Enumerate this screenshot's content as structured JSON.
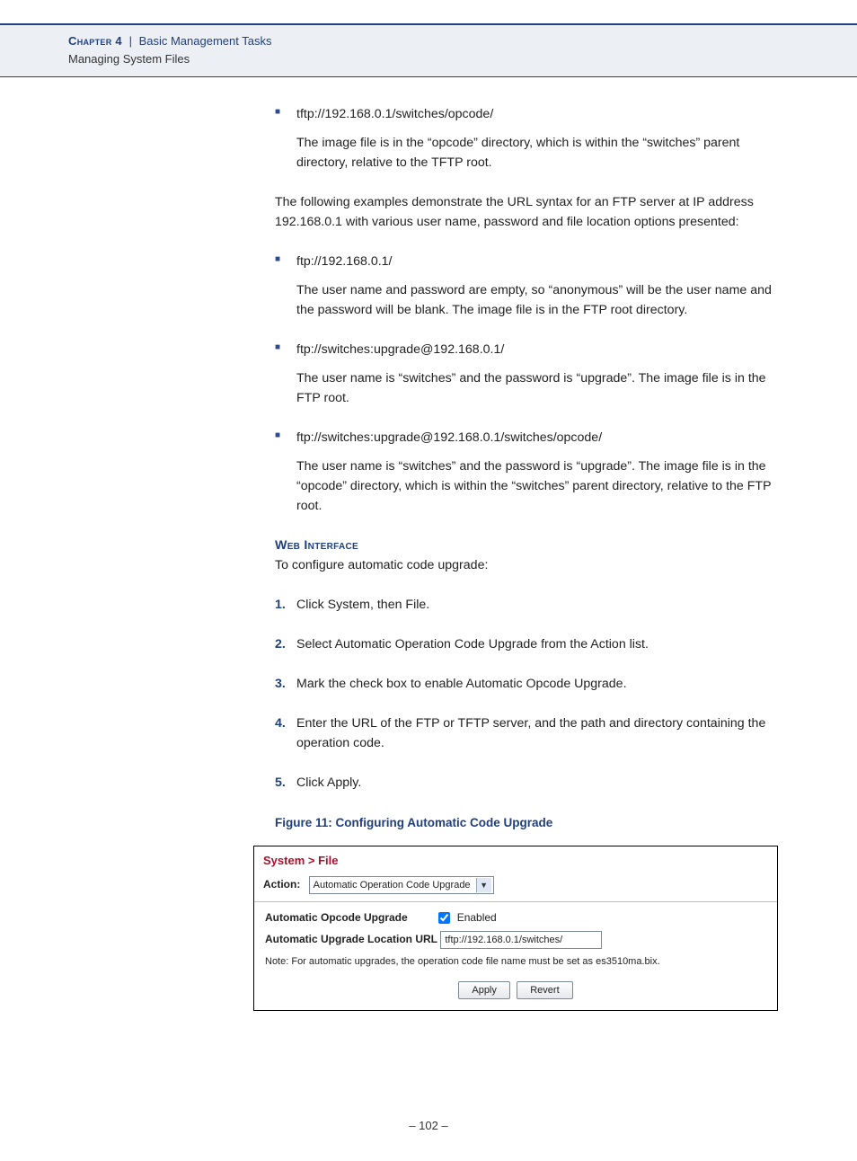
{
  "header": {
    "chapter_label": "Chapter 4",
    "divider": "|",
    "title": "Basic Management Tasks",
    "subtitle": "Managing System Files"
  },
  "tftp_example": {
    "url": "tftp://192.168.0.1/switches/opcode/",
    "desc": "The image file is in the “opcode” directory, which is within the “switches” parent directory, relative to the TFTP root."
  },
  "ftp_intro": "The following examples demonstrate the URL syntax for an FTP server at IP address 192.168.0.1 with various user name, password and file location options presented:",
  "ftp_examples": [
    {
      "url": "ftp://192.168.0.1/",
      "desc": "The user name and password are empty, so “anonymous” will be the user name and the password will be blank. The image file is in the FTP root directory."
    },
    {
      "url": "ftp://switches:upgrade@192.168.0.1/",
      "desc": "The user name is “switches” and the password is “upgrade”. The image file is in the FTP root."
    },
    {
      "url": "ftp://switches:upgrade@192.168.0.1/switches/opcode/",
      "desc": "The user name is “switches” and the password is “upgrade”. The image file is in the “opcode” directory, which is within the “switches” parent directory, relative to the FTP root."
    }
  ],
  "section_heading": "Web Interface",
  "section_intro": "To configure automatic code upgrade:",
  "steps": [
    "Click System, then File.",
    "Select Automatic Operation Code Upgrade from the Action list.",
    "Mark the check box to enable Automatic Opcode Upgrade.",
    "Enter the URL of the FTP or TFTP server, and the path and directory containing the operation code.",
    "Click Apply."
  ],
  "figure_caption": "Figure 11:  Configuring Automatic Code Upgrade",
  "screenshot": {
    "breadcrumb": "System > File",
    "action_label": "Action:",
    "action_value": "Automatic Operation Code Upgrade",
    "row1_label": "Automatic Opcode Upgrade",
    "row1_chk_label": "Enabled",
    "row2_label": "Automatic Upgrade Location URL",
    "row2_value": "tftp://192.168.0.1/switches/",
    "note": "Note: For automatic upgrades, the operation code file name must be set as es3510ma.bix.",
    "btn_apply": "Apply",
    "btn_revert": "Revert"
  },
  "page_number": "–  102  –"
}
